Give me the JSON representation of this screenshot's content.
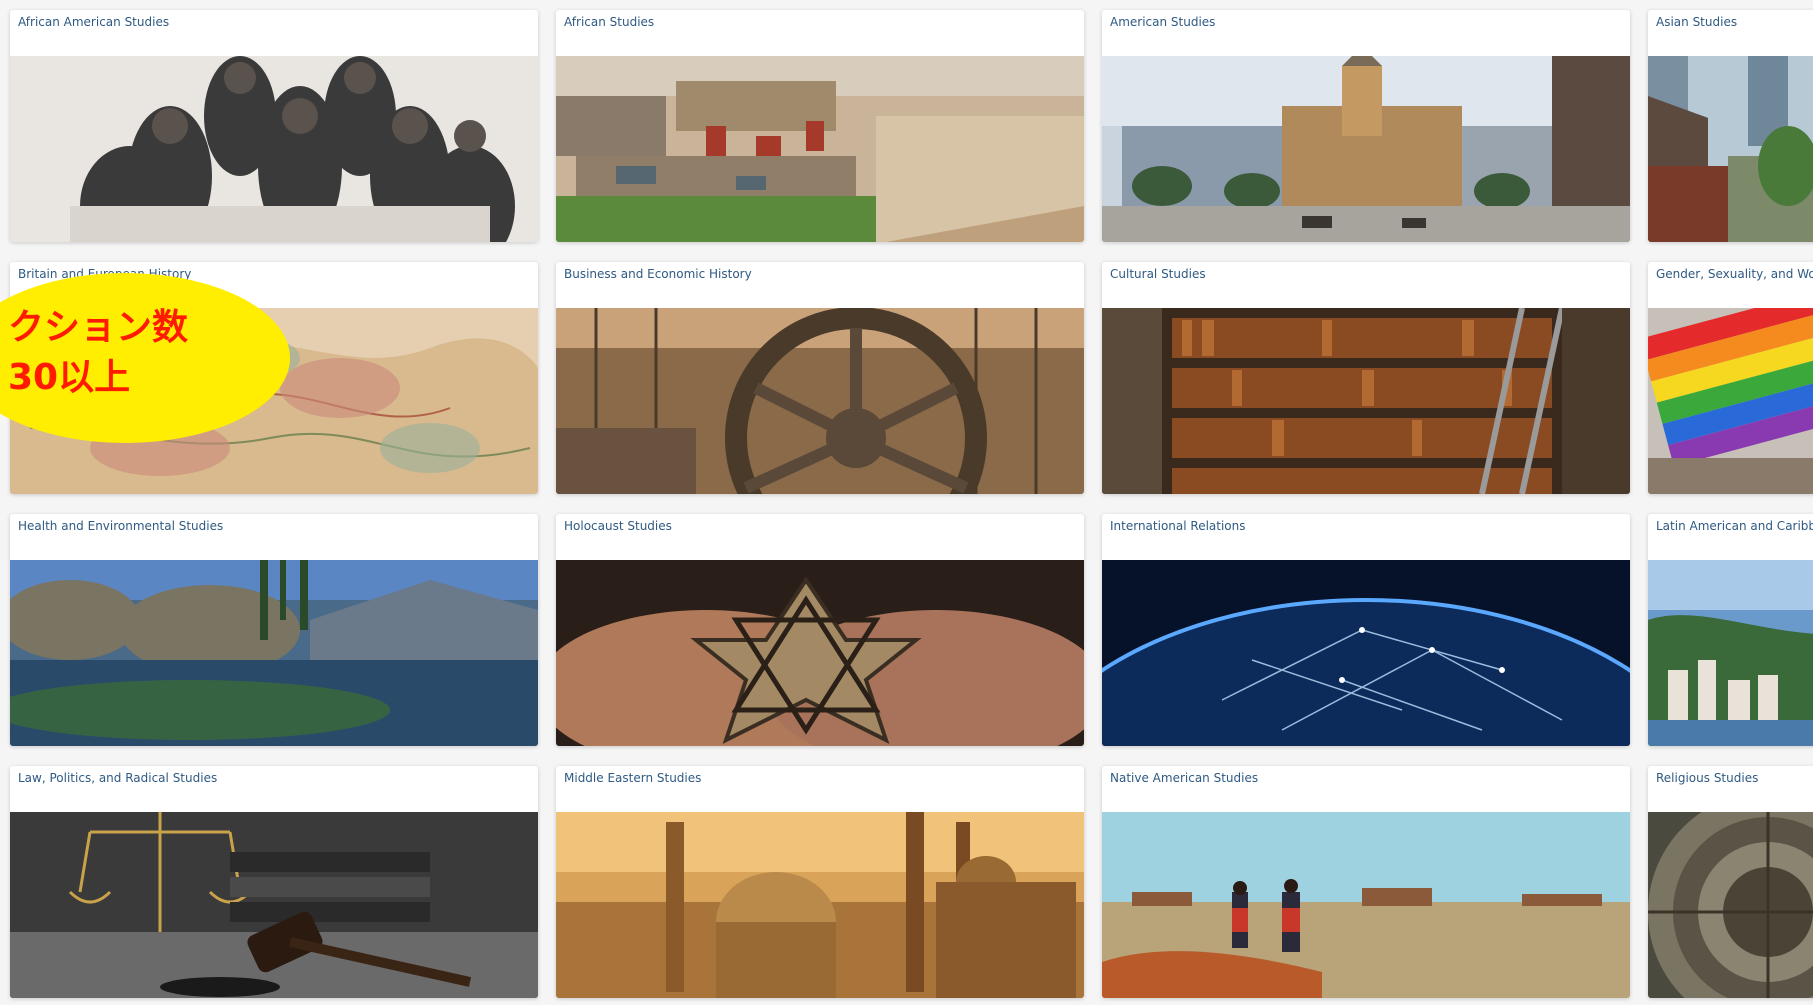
{
  "cards": [
    {
      "title": "African American Studies",
      "image": "portrait-of-seven-men-engraving"
    },
    {
      "title": "African Studies",
      "image": "coastal-market-fishing-boats"
    },
    {
      "title": "American Studies",
      "image": "independence-hall-street-scene"
    },
    {
      "title": "Asian Studies",
      "image": "asian-city-street"
    },
    {
      "title": "Britain and European History",
      "image": "antique-map-of-europe"
    },
    {
      "title": "Business and Economic History",
      "image": "industrial-gear-machinery"
    },
    {
      "title": "Cultural Studies",
      "image": "library-bookshelves-ladder"
    },
    {
      "title": "Gender, Sexuality, and Women's Studies",
      "image": "rainbow-flag"
    },
    {
      "title": "Health and Environmental Studies",
      "image": "mountain-river-stream"
    },
    {
      "title": "Holocaust Studies",
      "image": "hands-holding-cloth-star"
    },
    {
      "title": "International Relations",
      "image": "earth-network-connections"
    },
    {
      "title": "Latin American and Caribbean Studies",
      "image": "coastal-city-bay"
    },
    {
      "title": "Law, Politics, and Radical Studies",
      "image": "gavel-and-scales"
    },
    {
      "title": "Middle Eastern Studies",
      "image": "mosque-city-skyline"
    },
    {
      "title": "Native American Studies",
      "image": "two-people-desert-mesa"
    },
    {
      "title": "Religious Studies",
      "image": "ornate-dome-interior"
    }
  ],
  "callout": {
    "line1": "クション数",
    "line2": "30以上",
    "bg_color": "#ffee00",
    "text_color": "#ff1a00"
  }
}
